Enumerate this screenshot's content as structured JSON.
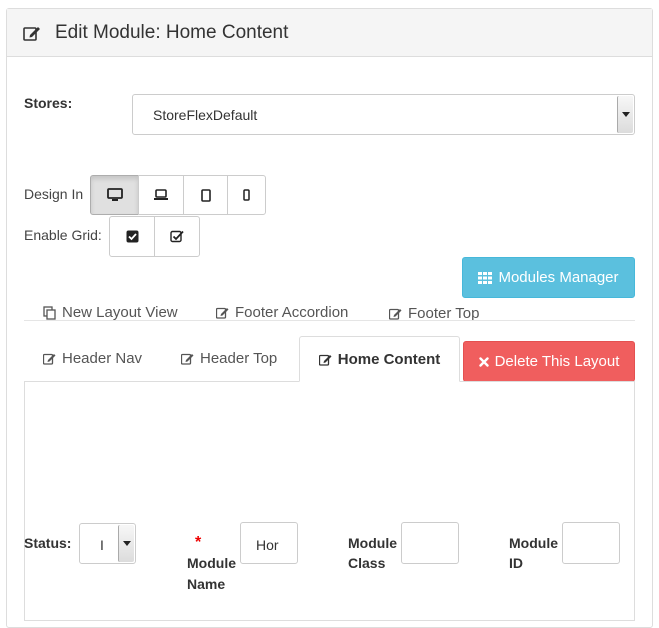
{
  "header": {
    "title": "Edit Module: Home Content",
    "icon": "edit-icon"
  },
  "stores": {
    "label": "Stores:",
    "selected": "StoreFlexDefault"
  },
  "design_in": {
    "label": "Design In",
    "options": [
      "desktop-icon",
      "laptop-icon",
      "tablet-icon",
      "mobile-icon"
    ],
    "active": "desktop-icon"
  },
  "enable_grid": {
    "label": "Enable Grid:",
    "options": [
      "checkbox-checked-icon",
      "checkbox-outline-icon"
    ]
  },
  "modules_manager": {
    "label": "Modules Manager",
    "icon": "grid-icon"
  },
  "layout_links": [
    {
      "label": "New Layout View",
      "icon": "copy-icon"
    },
    {
      "label": "Footer Accordion",
      "icon": "edit-icon"
    },
    {
      "label": "Footer Top",
      "icon": "edit-icon"
    }
  ],
  "tabs": [
    {
      "label": "Header Nav",
      "icon": "edit-icon"
    },
    {
      "label": "Header Top",
      "icon": "edit-icon"
    },
    {
      "label": "Home Content",
      "icon": "edit-icon",
      "active": true
    }
  ],
  "delete_button": {
    "label": "Delete This Layout",
    "icon": "close-icon"
  },
  "form": {
    "status_label": "Status:",
    "status_value": "I",
    "module_name_label_1": "Module",
    "module_name_label_2": "Name",
    "module_name_value": "Hor",
    "required_mark": "*",
    "module_class_label_1": "Module",
    "module_class_label_2": "Class",
    "module_class_value": "",
    "module_id_label_1": "Module",
    "module_id_label_2": "ID",
    "module_id_value": ""
  },
  "colors": {
    "info": "#5bc0de",
    "danger": "#f05e5e",
    "required": "#ee0000"
  }
}
